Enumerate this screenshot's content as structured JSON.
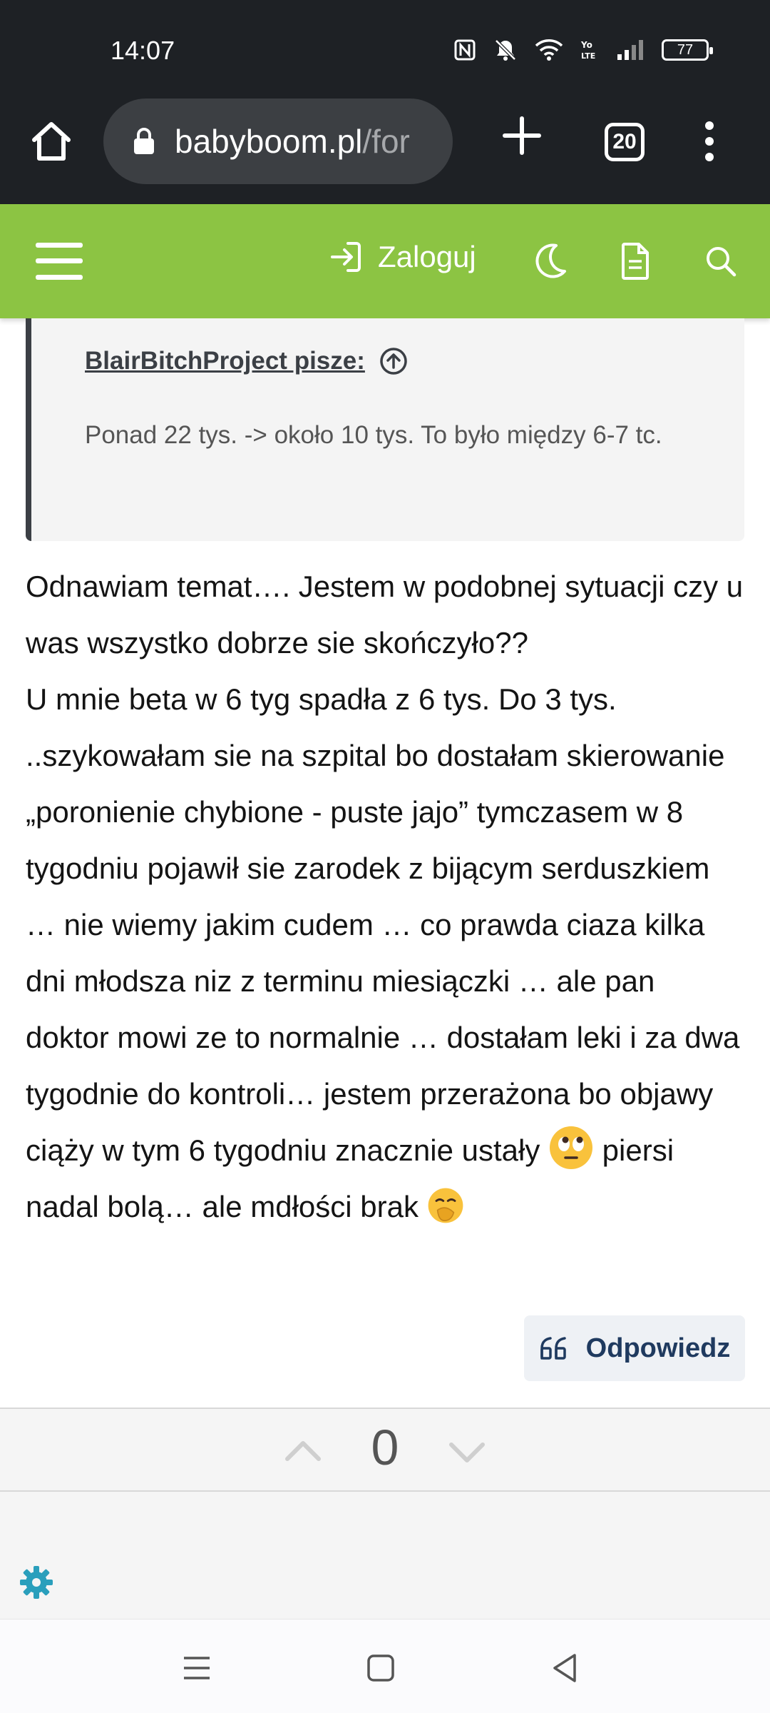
{
  "status_bar": {
    "time": "14:07",
    "battery": "77",
    "icons": [
      "nfc-icon",
      "bell-muted-icon",
      "wifi-icon",
      "volte-icon",
      "signal-icon",
      "battery-icon"
    ]
  },
  "browser": {
    "url_host": "babyboom.pl",
    "url_path": "/for",
    "tab_count": "20"
  },
  "site_header": {
    "login_label": "Zaloguj",
    "accent_color": "#8cc443"
  },
  "quote": {
    "author": "BlairBitchProject pisze:",
    "text": "Ponad 22 tys. -> około 10 tys. To było między 6-7 tc."
  },
  "post": {
    "text_part1": "Odnawiam temat…. Jestem w podobnej sytuacji czy u was wszystko dobrze sie skończyło??\nU mnie beta w 6 tyg spadła z 6 tys. Do 3 tys. ..szykowałam sie na szpital bo dostałam skierowanie „poronienie chybione - puste jajo” tymczasem w 8 tygodniu pojawił sie zarodek z bijącym serduszkiem … nie wiemy jakim cudem … co prawda ciaza kilka dni młodsza niz z terminu miesiączki … ale pan doktor mowi ze to normalnie … dostałam leki i za dwa tygodnie do kontroli… jestem przerażona bo objawy ciąży w tym 6 tygodniu znacznie ustały",
    "text_part2": " piersi nadal bolą… ale mdłości brak ",
    "emoji1": "eye-roll-emoji",
    "emoji2": "hand-over-mouth-emoji"
  },
  "reply": {
    "label": "Odpowiedz"
  },
  "vote": {
    "count": "0"
  }
}
